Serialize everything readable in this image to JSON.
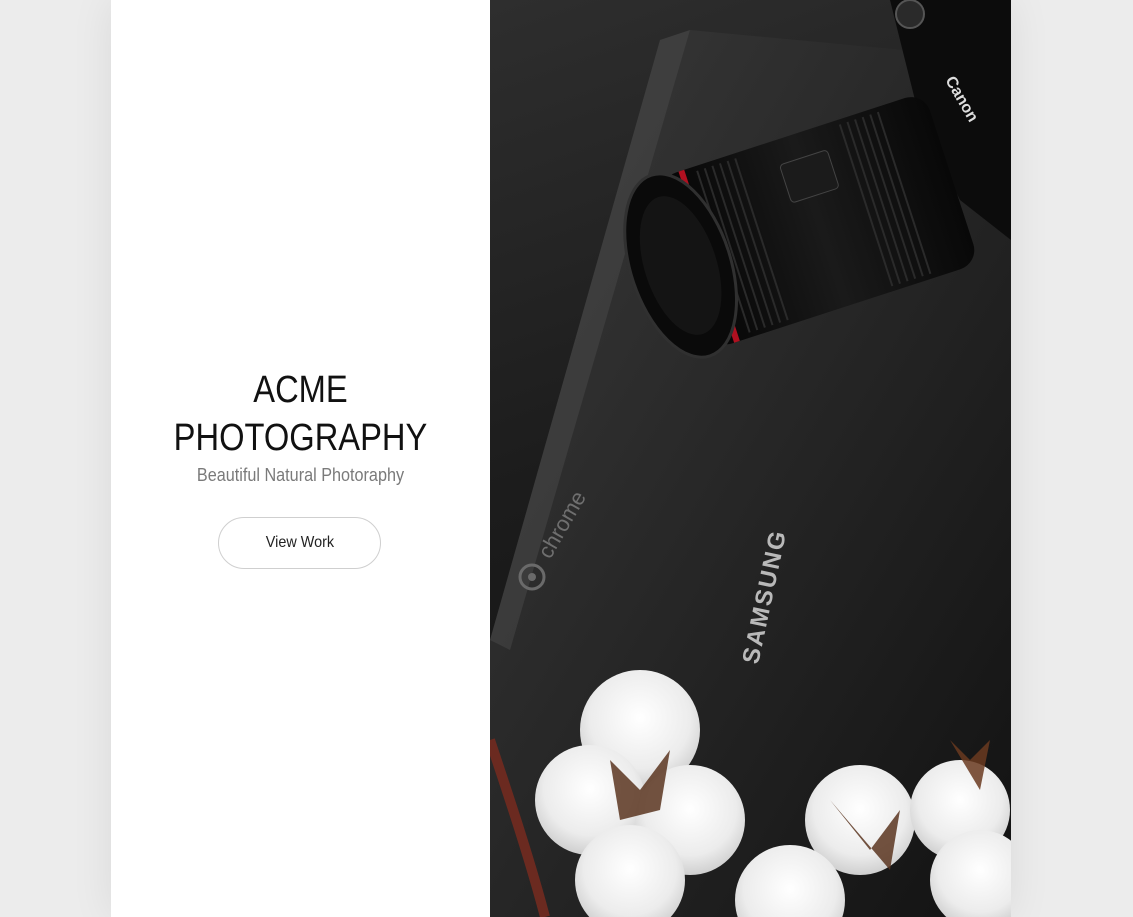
{
  "hero": {
    "title_line1": "ACME",
    "title_line2": "PHOTOGRAPHY",
    "subtitle": "Beautiful Natural Photoraphy",
    "cta_label": "View Work"
  },
  "image": {
    "chrome_label": "chrome",
    "samsung_label": "SAMSUNG",
    "canon_label": "Canon"
  },
  "colors": {
    "background": "#ececec",
    "panel": "#ffffff",
    "title": "#111111",
    "subtitle": "#7a7a7a",
    "button_border": "#cfcfcf"
  }
}
